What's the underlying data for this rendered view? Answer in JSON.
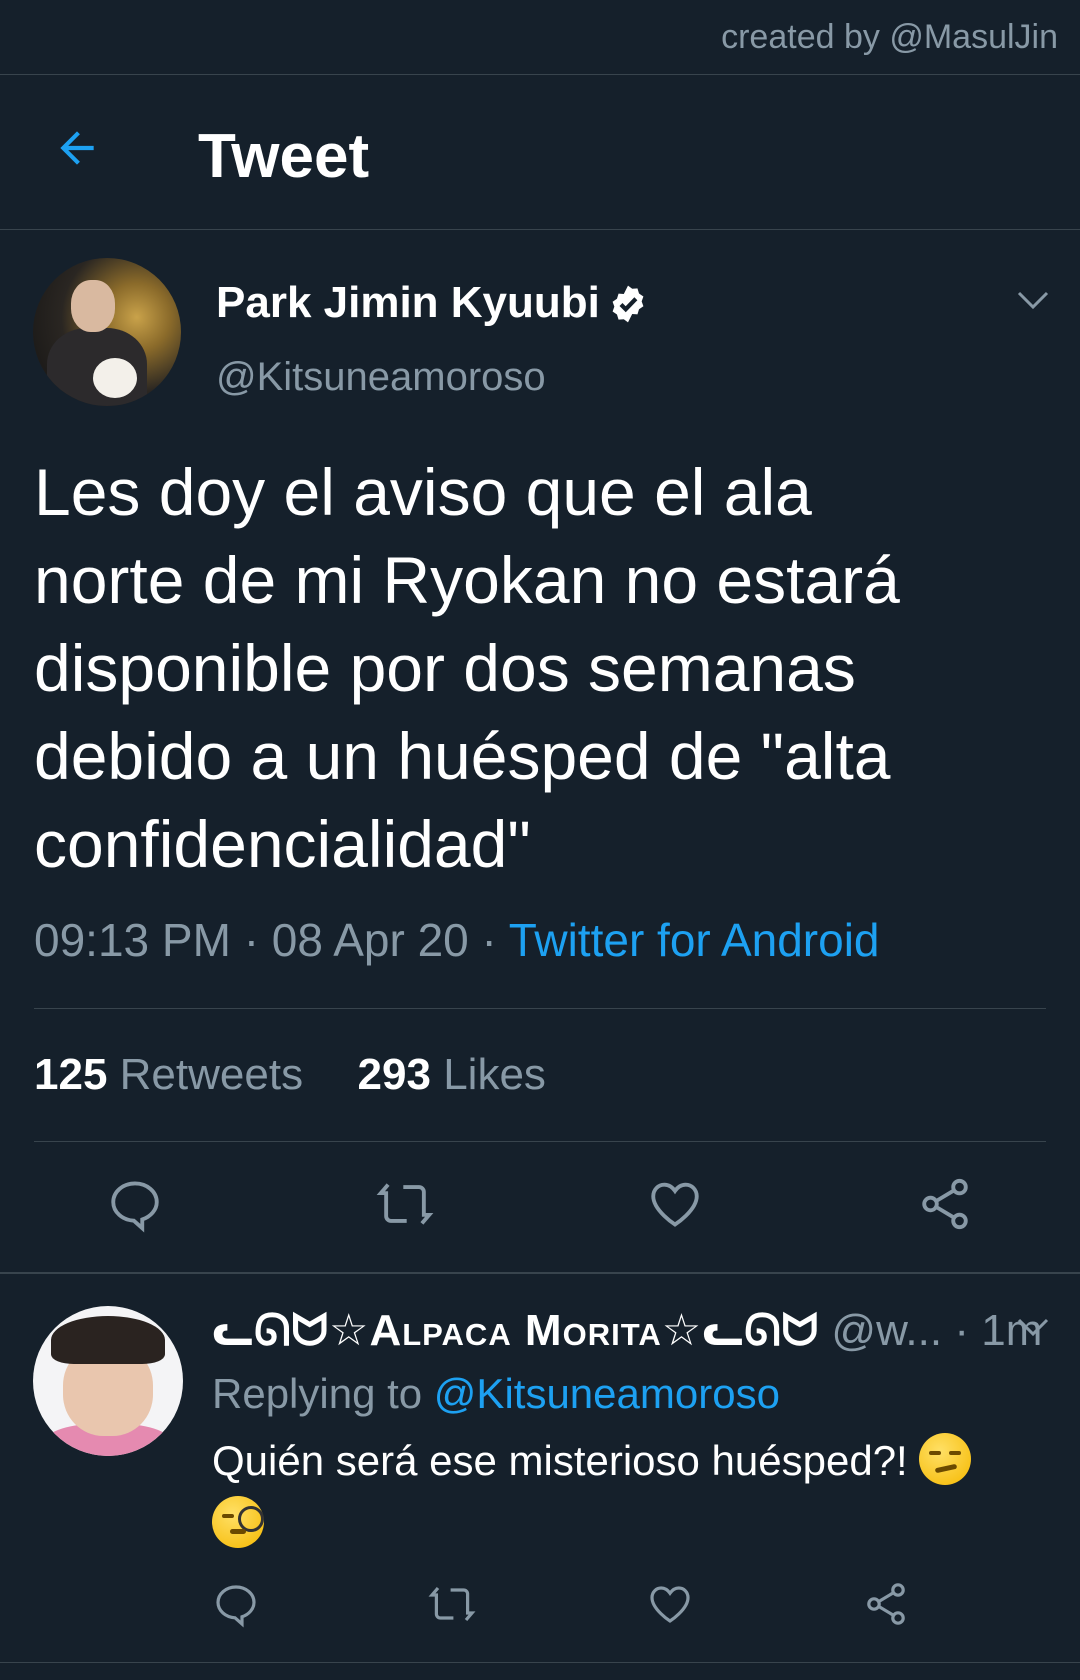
{
  "credit": "created by @MasulJin",
  "header": {
    "title": "Tweet"
  },
  "tweet": {
    "name": "Park Jimin Kyuubi",
    "handle": "@Kitsuneamoroso",
    "text": "Les doy el aviso que el ala\nnorte de mi Ryokan no estará\ndisponible por dos semanas\ndebido a un huésped de \"alta\nconfidencialidad\"",
    "time": "09:13 PM",
    "date": "08 Apr 20",
    "dot": "·",
    "source": "Twitter for Android",
    "retweets_count": "125",
    "retweets_label": "Retweets",
    "likes_count": "293",
    "likes_label": "Likes"
  },
  "reply": {
    "name": "ᓚᘏᗢ☆Alpaca Morita☆ᓚᘏᗢ",
    "handle": "@w...",
    "time": "1m",
    "replying_prefix": "Replying to",
    "replying_to": "@Kitsuneamoroso",
    "text": "Quién será ese misterioso huésped?!"
  },
  "colors": {
    "background": "#15202b",
    "accent": "#1da1f2",
    "secondary_text": "#8899a6",
    "divider": "#38444d"
  },
  "icons": [
    "back-arrow-icon",
    "verified-badge-icon",
    "chevron-down-icon",
    "reply-icon",
    "retweet-icon",
    "like-icon",
    "share-icon",
    "smirk-emoji-icon",
    "monocle-emoji-icon"
  ]
}
